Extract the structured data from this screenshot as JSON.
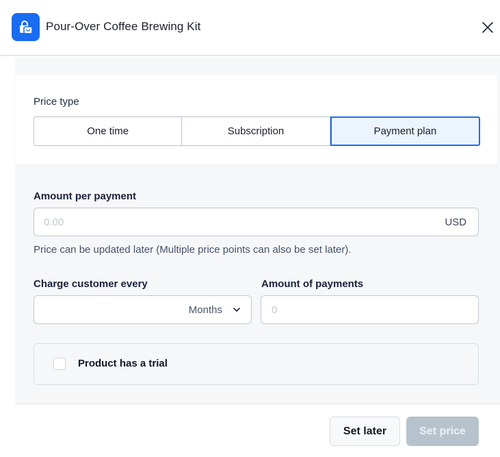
{
  "header": {
    "title": "Pour-Over Coffee Brewing Kit",
    "app_icon": "shopping-bag-lock-icon",
    "close_icon": "close-icon"
  },
  "price_type": {
    "label": "Price type",
    "options": [
      {
        "label": "One time",
        "selected": false
      },
      {
        "label": "Subscription",
        "selected": false
      },
      {
        "label": "Payment plan",
        "selected": true
      }
    ]
  },
  "amount_per_payment": {
    "label": "Amount per payment",
    "value": "",
    "placeholder": "0.00",
    "currency": "USD",
    "helper": "Price can be updated later (Multiple price points can also be set later)."
  },
  "charge_every": {
    "label": "Charge customer every",
    "selected": "Months",
    "chevron_icon": "chevron-down-icon"
  },
  "amount_of_payments": {
    "label": "Amount of payments",
    "value": "",
    "placeholder": "0"
  },
  "trial": {
    "label": "Product has a trial",
    "checked": false
  },
  "footer": {
    "set_later": "Set later",
    "set_price": "Set price"
  },
  "colors": {
    "accent": "#1a6cf0",
    "selected_bg": "#ebf4ff",
    "disabled_button": "#b7c3cc"
  }
}
